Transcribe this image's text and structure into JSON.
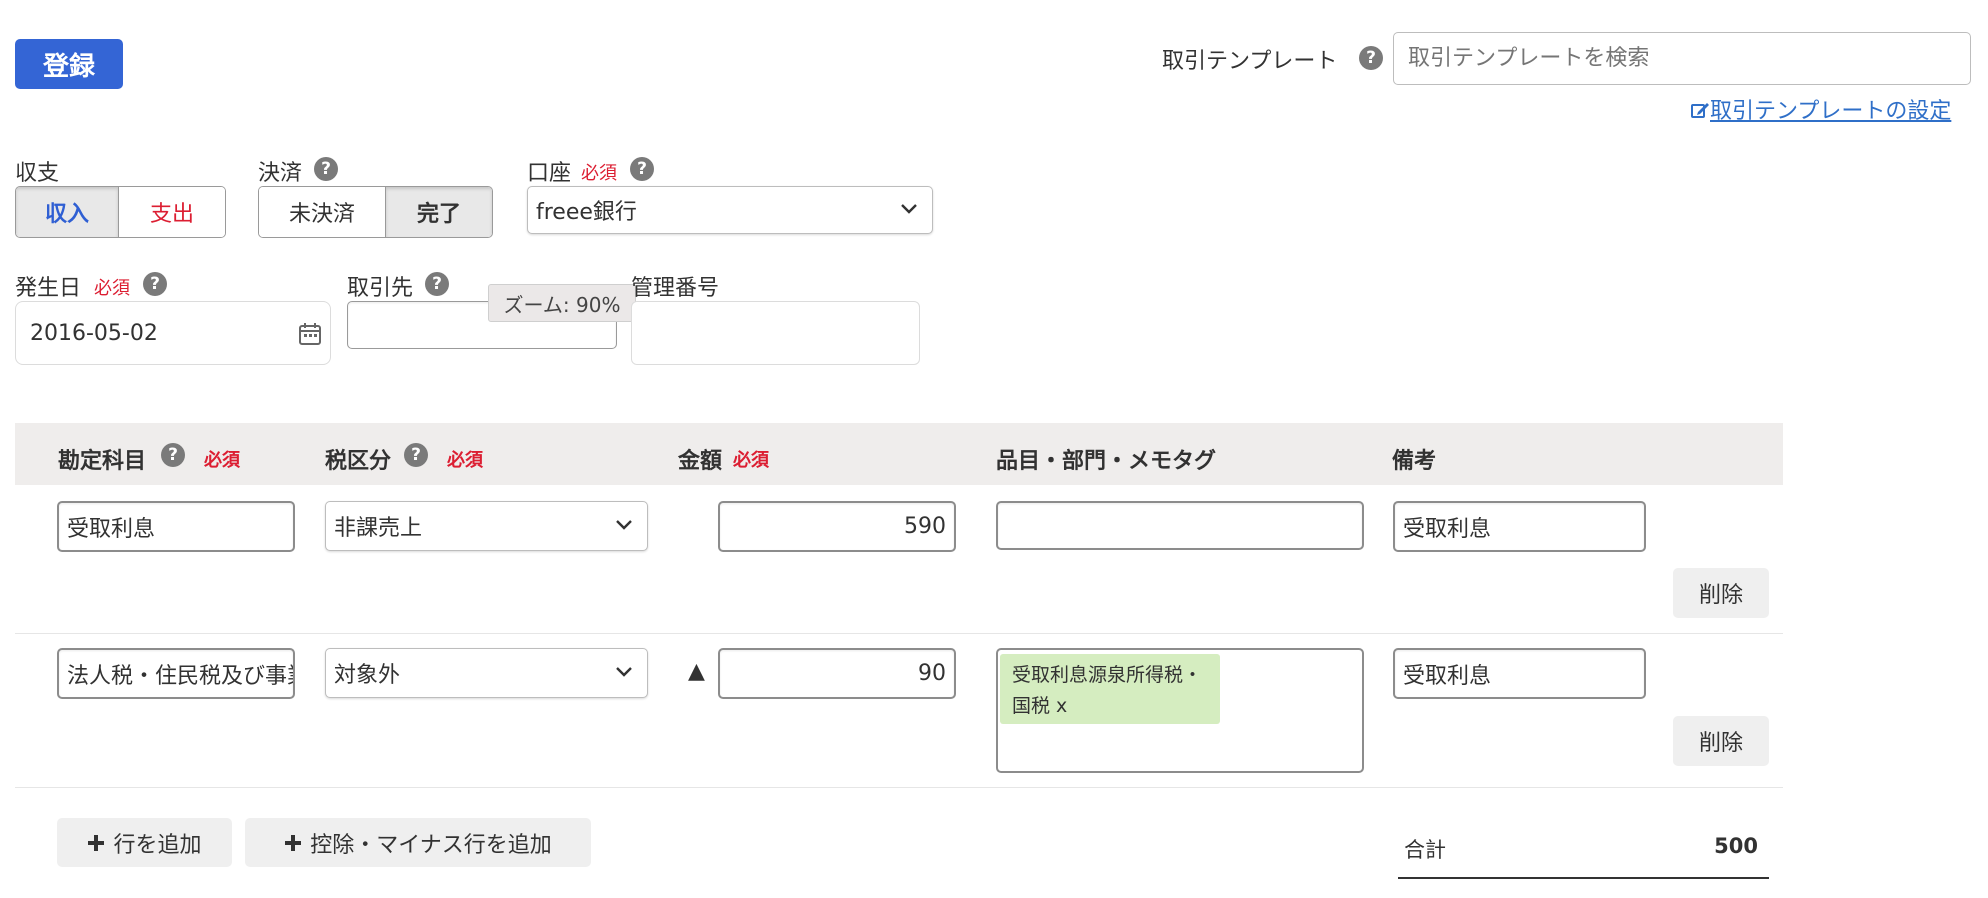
{
  "toolbar": {
    "register_label": "登録"
  },
  "template": {
    "label": "取引テンプレート",
    "search_placeholder": "取引テンプレートを検索",
    "settings_link": "取引テンプレートの設定"
  },
  "income_expense": {
    "label": "収支",
    "income": "収入",
    "expense": "支出",
    "selected": "収入"
  },
  "settlement": {
    "label": "決済",
    "unsettled": "未決済",
    "done": "完了",
    "selected": "完了"
  },
  "account": {
    "label": "口座",
    "required": "必須",
    "value": "freee銀行"
  },
  "date": {
    "label": "発生日",
    "required": "必須",
    "value": "2016-05-02"
  },
  "partner": {
    "label": "取引先",
    "value": ""
  },
  "zoom_tooltip": "ズーム: 90%",
  "control_number": {
    "label": "管理番号",
    "value": ""
  },
  "table": {
    "headers": {
      "account_title": "勘定科目",
      "tax_category": "税区分",
      "amount": "金額",
      "tags": "品目・部門・メモタグ",
      "remarks": "備考",
      "required": "必須"
    },
    "rows": [
      {
        "account_title": "受取利息",
        "tax_category": "非課売上",
        "minus": "",
        "amount": "590",
        "tag": "",
        "remarks": "受取利息",
        "delete": "削除"
      },
      {
        "account_title": "法人税・住民税及び事業税",
        "tax_category": "対象外",
        "minus": "▲",
        "amount": "90",
        "tag": "受取利息源泉所得税・国税 x",
        "remarks": "受取利息",
        "delete": "削除"
      }
    ]
  },
  "actions": {
    "add_row": "行を追加",
    "add_minus_row": "控除・マイナス行を追加"
  },
  "total": {
    "label": "合計",
    "value": "500"
  },
  "colors": {
    "primary": "#2f5fd3",
    "required_red": "#dc1e32",
    "tag_green": "#d5edc0",
    "link_blue": "#2f6fc8"
  }
}
